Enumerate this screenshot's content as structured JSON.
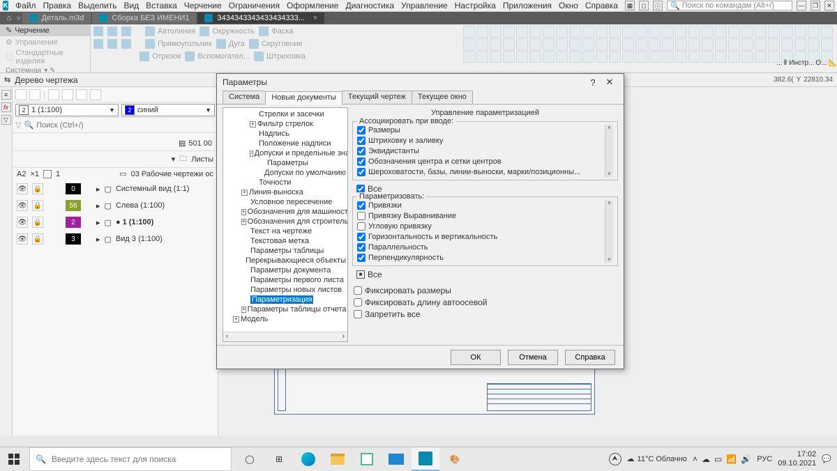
{
  "menus": [
    "Файл",
    "Правка",
    "Выделить",
    "Вид",
    "Вставка",
    "Черчение",
    "Ограничения",
    "Оформление",
    "Диагностика",
    "Управление",
    "Настройка",
    "Приложения",
    "Окно",
    "Справка"
  ],
  "search_placeholder": "Поиск по командам (Alt+/)",
  "doc_tabs": [
    {
      "label": "Деталь.m3d",
      "active": false
    },
    {
      "label": "Сборка БЕЗ ИМЕНИ1",
      "active": false
    },
    {
      "label": "3434343343433434333...",
      "active": true
    }
  ],
  "ribbon_tabs": [
    {
      "label": "Черчение",
      "active": true
    },
    {
      "label": "Управление",
      "active": false,
      "dim": true
    },
    {
      "label": "Стандартные изделия",
      "active": false,
      "dim": true
    }
  ],
  "ribbon_sys": "Системная",
  "ribbon_items_row1": [
    "Автолиния",
    "Окружность",
    "Фаска"
  ],
  "ribbon_items_row2": [
    "Прямоугольник",
    "Дуга",
    "Скругление"
  ],
  "ribbon_items_row3": [
    "Отрезок",
    "Вспомогател...",
    "Штриховка"
  ],
  "tree_title": "Дерево чертежа",
  "scale_combo": {
    "num": "2",
    "text": "1 (1:100)"
  },
  "color_combo": {
    "num": "2",
    "text": "синий"
  },
  "tree_search": "Поиск (Ctrl+/)",
  "doc_number": "501 00",
  "sheets_label": "Листы",
  "sheet_row": {
    "format": "A2",
    "mult": "×1",
    "num": "1",
    "desc": "03 Рабочие чертежи ос"
  },
  "views": [
    {
      "color": "#000",
      "num": "0",
      "label": "Системный вид (1:1)"
    },
    {
      "color": "#8aa02a",
      "num": "56",
      "label": "Слева (1:100)"
    },
    {
      "color": "#a020a0",
      "num": "2",
      "label": "1 (1:100)",
      "bold": true
    },
    {
      "color": "#000",
      "num": "3",
      "label": "Вид 3 (1:100)"
    }
  ],
  "coords": {
    "x": "382.6(",
    "y": "22810.34"
  },
  "mini_panels": [
    "...",
    "Инстр...",
    "О...",
    ""
  ],
  "dialog": {
    "title": "Параметры",
    "tabs": [
      "Система",
      "Новые документы",
      "Текущий чертеж",
      "Текущее окно"
    ],
    "active_tab": 1,
    "tree": [
      {
        "lvl": 3,
        "exp": "",
        "label": "Стрелки и засечки"
      },
      {
        "lvl": 3,
        "exp": "+",
        "label": "Фильтр стрелок"
      },
      {
        "lvl": 3,
        "exp": "",
        "label": "Надпись"
      },
      {
        "lvl": 3,
        "exp": "",
        "label": "Положение надписи"
      },
      {
        "lvl": 3,
        "exp": "-",
        "label": "Допуски и предельные знач"
      },
      {
        "lvl": 4,
        "exp": "",
        "label": "Параметры"
      },
      {
        "lvl": 4,
        "exp": "",
        "label": "Допуски по умолчанию"
      },
      {
        "lvl": 3,
        "exp": "",
        "label": "Точности"
      },
      {
        "lvl": 2,
        "exp": "+",
        "label": "Линия-выноска"
      },
      {
        "lvl": 2,
        "exp": "",
        "label": "Условное пересечение"
      },
      {
        "lvl": 2,
        "exp": "+",
        "label": "Обозначения для машиностроен"
      },
      {
        "lvl": 2,
        "exp": "+",
        "label": "Обозначения для строительств"
      },
      {
        "lvl": 2,
        "exp": "",
        "label": "Текст на чертеже"
      },
      {
        "lvl": 2,
        "exp": "",
        "label": "Текстовая метка"
      },
      {
        "lvl": 2,
        "exp": "",
        "label": "Параметры таблицы"
      },
      {
        "lvl": 2,
        "exp": "",
        "label": "Перекрывающиеся объекты"
      },
      {
        "lvl": 2,
        "exp": "",
        "label": "Параметры документа"
      },
      {
        "lvl": 2,
        "exp": "",
        "label": "Параметры первого листа"
      },
      {
        "lvl": 2,
        "exp": "",
        "label": "Параметры новых листов"
      },
      {
        "lvl": 2,
        "exp": "",
        "label": "Параметризация",
        "sel": true
      },
      {
        "lvl": 2,
        "exp": "+",
        "label": "Параметры таблицы отчета"
      },
      {
        "lvl": 1,
        "exp": "+",
        "label": "Модель"
      }
    ],
    "right_title": "Управление параметризацией",
    "group1": {
      "legend": "Ассоциировать при вводе:",
      "items": [
        {
          "checked": true,
          "label": "Размеры"
        },
        {
          "checked": true,
          "label": "Штриховку и заливку"
        },
        {
          "checked": true,
          "label": "Эквидистанты"
        },
        {
          "checked": true,
          "label": "Обозначения центра и сетки центров"
        },
        {
          "checked": true,
          "label": "Шероховатости, базы, линии-выноски, марки/позиционны..."
        }
      ],
      "all": {
        "checked": true,
        "label": "Все"
      }
    },
    "group2": {
      "legend": "Параметризовать:",
      "items": [
        {
          "checked": true,
          "label": "Привязки"
        },
        {
          "checked": false,
          "label": "Привязку Выравнивание"
        },
        {
          "checked": false,
          "label": "Угловую привязку"
        },
        {
          "checked": true,
          "label": "Горизонтальность и вертикальность"
        },
        {
          "checked": true,
          "label": "Параллельность"
        },
        {
          "checked": true,
          "label": "Перпендикулярность"
        }
      ],
      "all": {
        "tri": true,
        "label": "Все"
      }
    },
    "standalone": [
      {
        "checked": false,
        "label": "Фиксировать размеры"
      },
      {
        "checked": false,
        "label": "Фиксировать длину автоосевой"
      },
      {
        "checked": false,
        "label": "Запретить все"
      }
    ],
    "buttons": {
      "ok": "ОК",
      "cancel": "Отмена",
      "help": "Справка"
    }
  },
  "taskbar": {
    "search": "Введите здесь текст для поиска",
    "weather": "11°C  Облачно",
    "lang": "РУС",
    "time": "17:02",
    "date": "09.10.2021"
  }
}
